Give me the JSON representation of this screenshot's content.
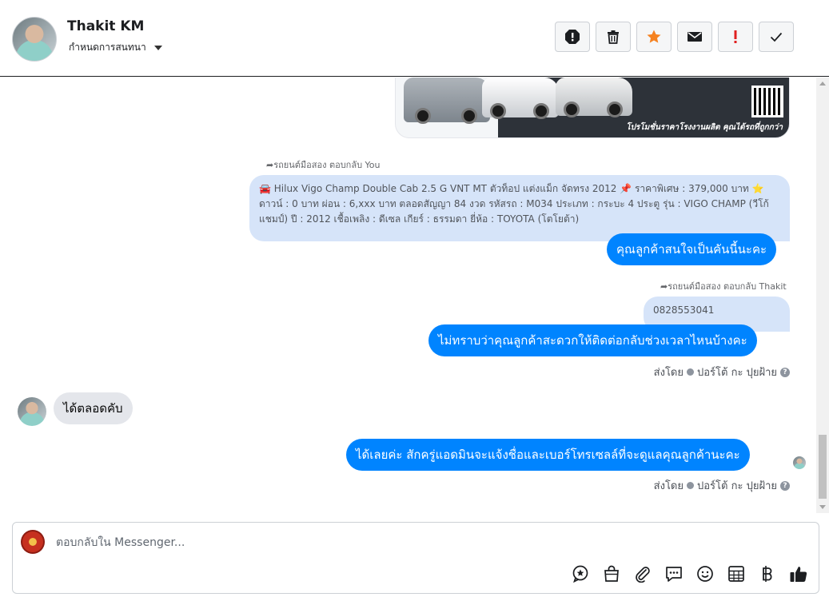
{
  "header": {
    "name": "Thakit KM",
    "sub_label": "กำหนดการสนทนา",
    "actions": [
      {
        "name": "report-button",
        "icon": "alert-circle-icon"
      },
      {
        "name": "delete-button",
        "icon": "trash-icon"
      },
      {
        "name": "star-button",
        "icon": "star-icon"
      },
      {
        "name": "mail-button",
        "icon": "envelope-icon"
      },
      {
        "name": "important-button",
        "icon": "exclamation-icon"
      },
      {
        "name": "done-button",
        "icon": "check-icon"
      }
    ]
  },
  "image_card": {
    "banner_text": "โปรโมชั่นราคาโรงงานผลิต คุณได้รถที่ถูกกว่า"
  },
  "messages": {
    "reply_label_1": "รถยนต์มือสอง ตอบกลับ You",
    "quoted_1": "🚘 Hilux Vigo Champ Double Cab 2.5 G VNT MT ตัวท็อป แต่งแม็ก จัดทรง 2012 📌 ราคาพิเศษ : 379,000 บาท ⭐ ดาวน์ : 0 บาท ผ่อน : 6,xxx บาท ตลอดสัญญา 84 งวด รหัสรถ : M034 ประเภท : กระบะ 4 ประตู รุ่น : VIGO CHAMP (วีโก้ แชมป์) ปี : 2012 เชื้อเพลิง : ดีเซล เกียร์ : ธรรมดา ยี่ห้อ : TOYOTA (โตโยต้า)",
    "out_1": "คุณลูกค้าสนใจเป็นคันนี้นะคะ",
    "reply_label_2": "รถยนต์มือสอง ตอบกลับ Thakit",
    "quoted_2": "0828553041",
    "out_2": "ไม่ทราบว่าคุณลูกค้าสะดวกให้ติดต่อกลับช่วงเวลาไหนบ้างคะ",
    "sent_by_label_1": "ส่งโดย",
    "sent_by_name_1": "ปอร์โต้ กะ ปุยฝ้าย",
    "in_1": "ได้ตลอดคับ",
    "out_3": "ได้เลยค่ะ สักครู่แอดมินจะแจ้งชื่อและเบอร์โทรเซลล์ที่จะดูแลคุณลูกค้านะคะ",
    "sent_by_label_2": "ส่งโดย",
    "sent_by_name_2": "ปอร์โต้ กะ ปุยฝ้าย"
  },
  "composer": {
    "placeholder": "ตอบกลับใน Messenger...",
    "tools": [
      "chat-star-icon",
      "bag-icon",
      "paperclip-icon",
      "chat-dots-icon",
      "smile-icon",
      "table-icon",
      "baht-icon",
      "thumbs-up-icon"
    ]
  },
  "colors": {
    "accent": "#0084ff",
    "quoted_bg": "#d6e4f9",
    "incoming_bg": "#e4e6eb",
    "star": "#f58220",
    "important": "#e02020"
  }
}
